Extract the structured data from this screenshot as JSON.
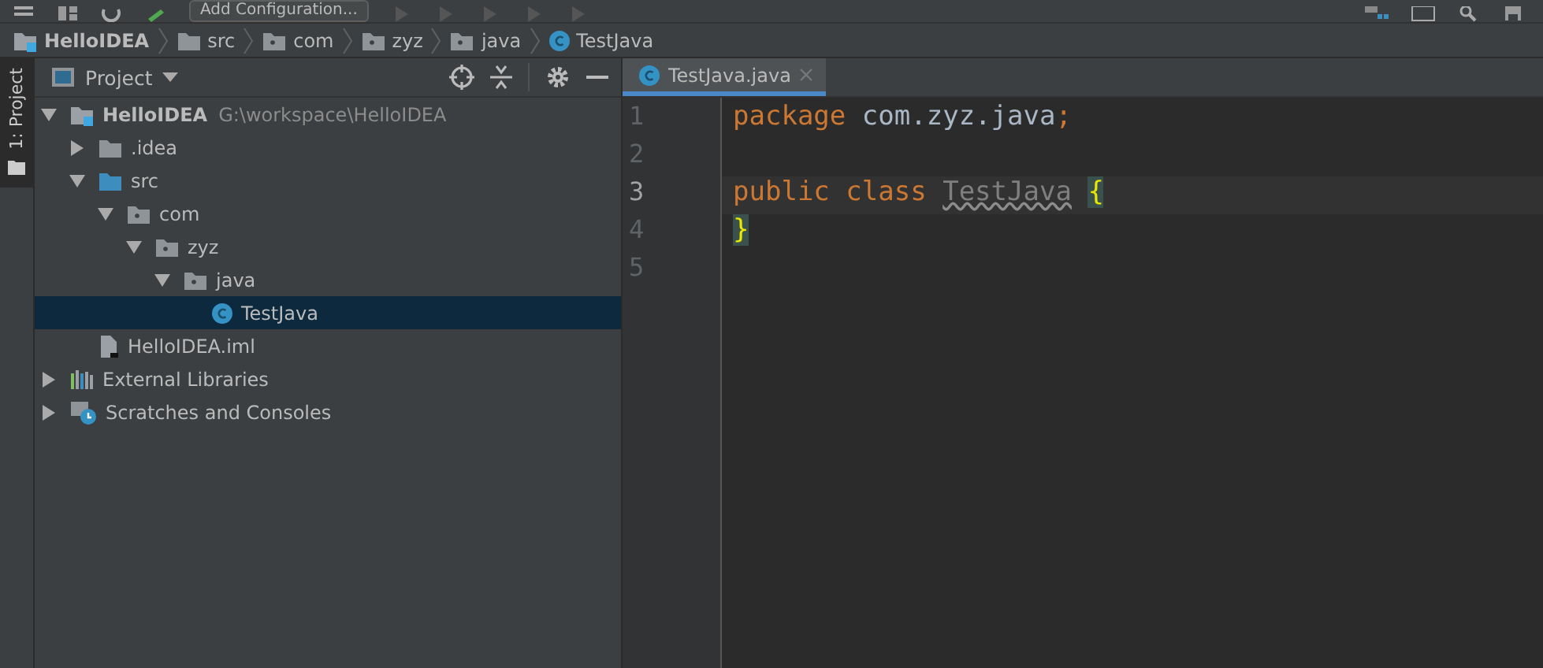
{
  "toolbar": {
    "run_config": "Add Configuration..."
  },
  "breadcrumb": [
    {
      "label": "HelloIDEA",
      "kind": "module"
    },
    {
      "label": "src",
      "kind": "folder"
    },
    {
      "label": "com",
      "kind": "package"
    },
    {
      "label": "zyz",
      "kind": "package"
    },
    {
      "label": "java",
      "kind": "package"
    },
    {
      "label": "TestJava",
      "kind": "class"
    }
  ],
  "side_tabs": [
    {
      "label": "1: Project",
      "selected": true
    }
  ],
  "project_panel": {
    "title": "Project",
    "tree": [
      {
        "label": "HelloIDEA",
        "path": "G:\\workspace\\HelloIDEA",
        "kind": "module",
        "expanded": true,
        "selected": false,
        "children": [
          {
            "label": ".idea",
            "kind": "folder",
            "expanded": false,
            "selected": false
          },
          {
            "label": "src",
            "kind": "source",
            "expanded": true,
            "selected": false,
            "children": [
              {
                "label": "com",
                "kind": "package",
                "expanded": true,
                "selected": false,
                "children": [
                  {
                    "label": "zyz",
                    "kind": "package",
                    "expanded": true,
                    "selected": false,
                    "children": [
                      {
                        "label": "java",
                        "kind": "package",
                        "expanded": true,
                        "selected": false,
                        "children": [
                          {
                            "label": "TestJava",
                            "kind": "class",
                            "selected": true
                          }
                        ]
                      }
                    ]
                  }
                ]
              }
            ]
          },
          {
            "label": "HelloIDEA.iml",
            "kind": "file",
            "selected": false
          }
        ]
      },
      {
        "label": "External Libraries",
        "kind": "libraries",
        "expanded": false,
        "selected": false
      },
      {
        "label": "Scratches and Consoles",
        "kind": "scratches",
        "expanded": false,
        "selected": false
      }
    ]
  },
  "editor": {
    "tabs": [
      {
        "label": "TestJava.java",
        "selected": true
      }
    ],
    "lines": [
      {
        "number": "1",
        "current": false,
        "tokens": [
          {
            "text": "package",
            "kind": "keyword"
          },
          {
            "text": "com.zyz.java",
            "kind": "plain"
          },
          {
            "text": ";",
            "kind": "keyword",
            "attached": true
          }
        ]
      },
      {
        "number": "2",
        "current": false
      },
      {
        "number": "3",
        "current": true,
        "tokens": [
          {
            "text": "public class",
            "kind": "keyword"
          },
          {
            "text": "TestJava",
            "kind": "unused"
          },
          {
            "text": "{",
            "kind": "brace"
          }
        ]
      },
      {
        "number": "4",
        "current": false,
        "tokens": [
          {
            "text": "}",
            "kind": "brace"
          }
        ]
      },
      {
        "number": "5",
        "current": false
      }
    ]
  }
}
